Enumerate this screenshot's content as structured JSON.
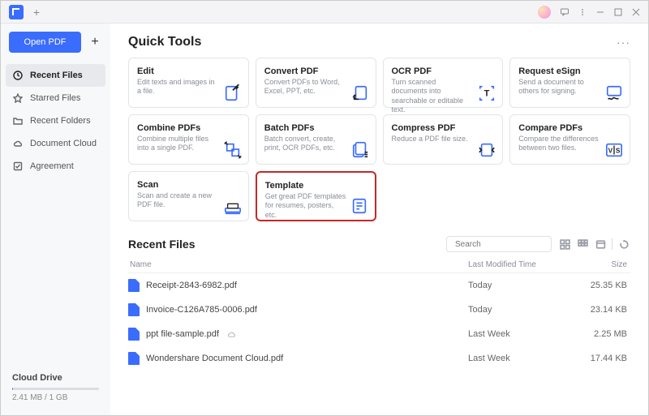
{
  "titlebar": {
    "newtab": "+"
  },
  "sidebar": {
    "open_label": "Open PDF",
    "items": [
      {
        "label": "Recent Files",
        "icon": "clock-icon",
        "active": true
      },
      {
        "label": "Starred Files",
        "icon": "star-icon"
      },
      {
        "label": "Recent Folders",
        "icon": "folder-icon"
      },
      {
        "label": "Document Cloud",
        "icon": "cloud-icon"
      },
      {
        "label": "Agreement",
        "icon": "checkbox-icon"
      }
    ],
    "cloud": {
      "title": "Cloud Drive",
      "usage": "2.41 MB / 1 GB"
    }
  },
  "quick_tools": {
    "heading": "Quick Tools",
    "more": "···",
    "cards": [
      {
        "title": "Edit",
        "desc": "Edit texts and images in a file."
      },
      {
        "title": "Convert PDF",
        "desc": "Convert PDFs to Word, Excel, PPT, etc."
      },
      {
        "title": "OCR PDF",
        "desc": "Turn scanned documents into searchable or editable text."
      },
      {
        "title": "Request eSign",
        "desc": "Send a document to others for signing."
      },
      {
        "title": "Combine PDFs",
        "desc": "Combine multiple files into a single PDF."
      },
      {
        "title": "Batch PDFs",
        "desc": "Batch convert, create, print, OCR PDFs, etc."
      },
      {
        "title": "Compress PDF",
        "desc": "Reduce a PDF file size."
      },
      {
        "title": "Compare PDFs",
        "desc": "Compare the differences between two files."
      },
      {
        "title": "Scan",
        "desc": "Scan and create a new PDF file."
      },
      {
        "title": "Template",
        "desc": "Get great PDF templates for resumes, posters, etc.",
        "highlight": true
      }
    ]
  },
  "recent": {
    "heading": "Recent Files",
    "search_placeholder": "Search",
    "columns": {
      "name": "Name",
      "modified": "Last Modified Time",
      "size": "Size"
    },
    "rows": [
      {
        "name": "Receipt-2843-6982.pdf",
        "modified": "Today",
        "size": "25.35 KB"
      },
      {
        "name": "Invoice-C126A785-0006.pdf",
        "modified": "Today",
        "size": "23.14 KB"
      },
      {
        "name": "ppt file-sample.pdf",
        "modified": "Last Week",
        "size": "2.25 MB",
        "cloud": true
      },
      {
        "name": "Wondershare Document Cloud.pdf",
        "modified": "Last Week",
        "size": "17.44 KB"
      }
    ]
  }
}
